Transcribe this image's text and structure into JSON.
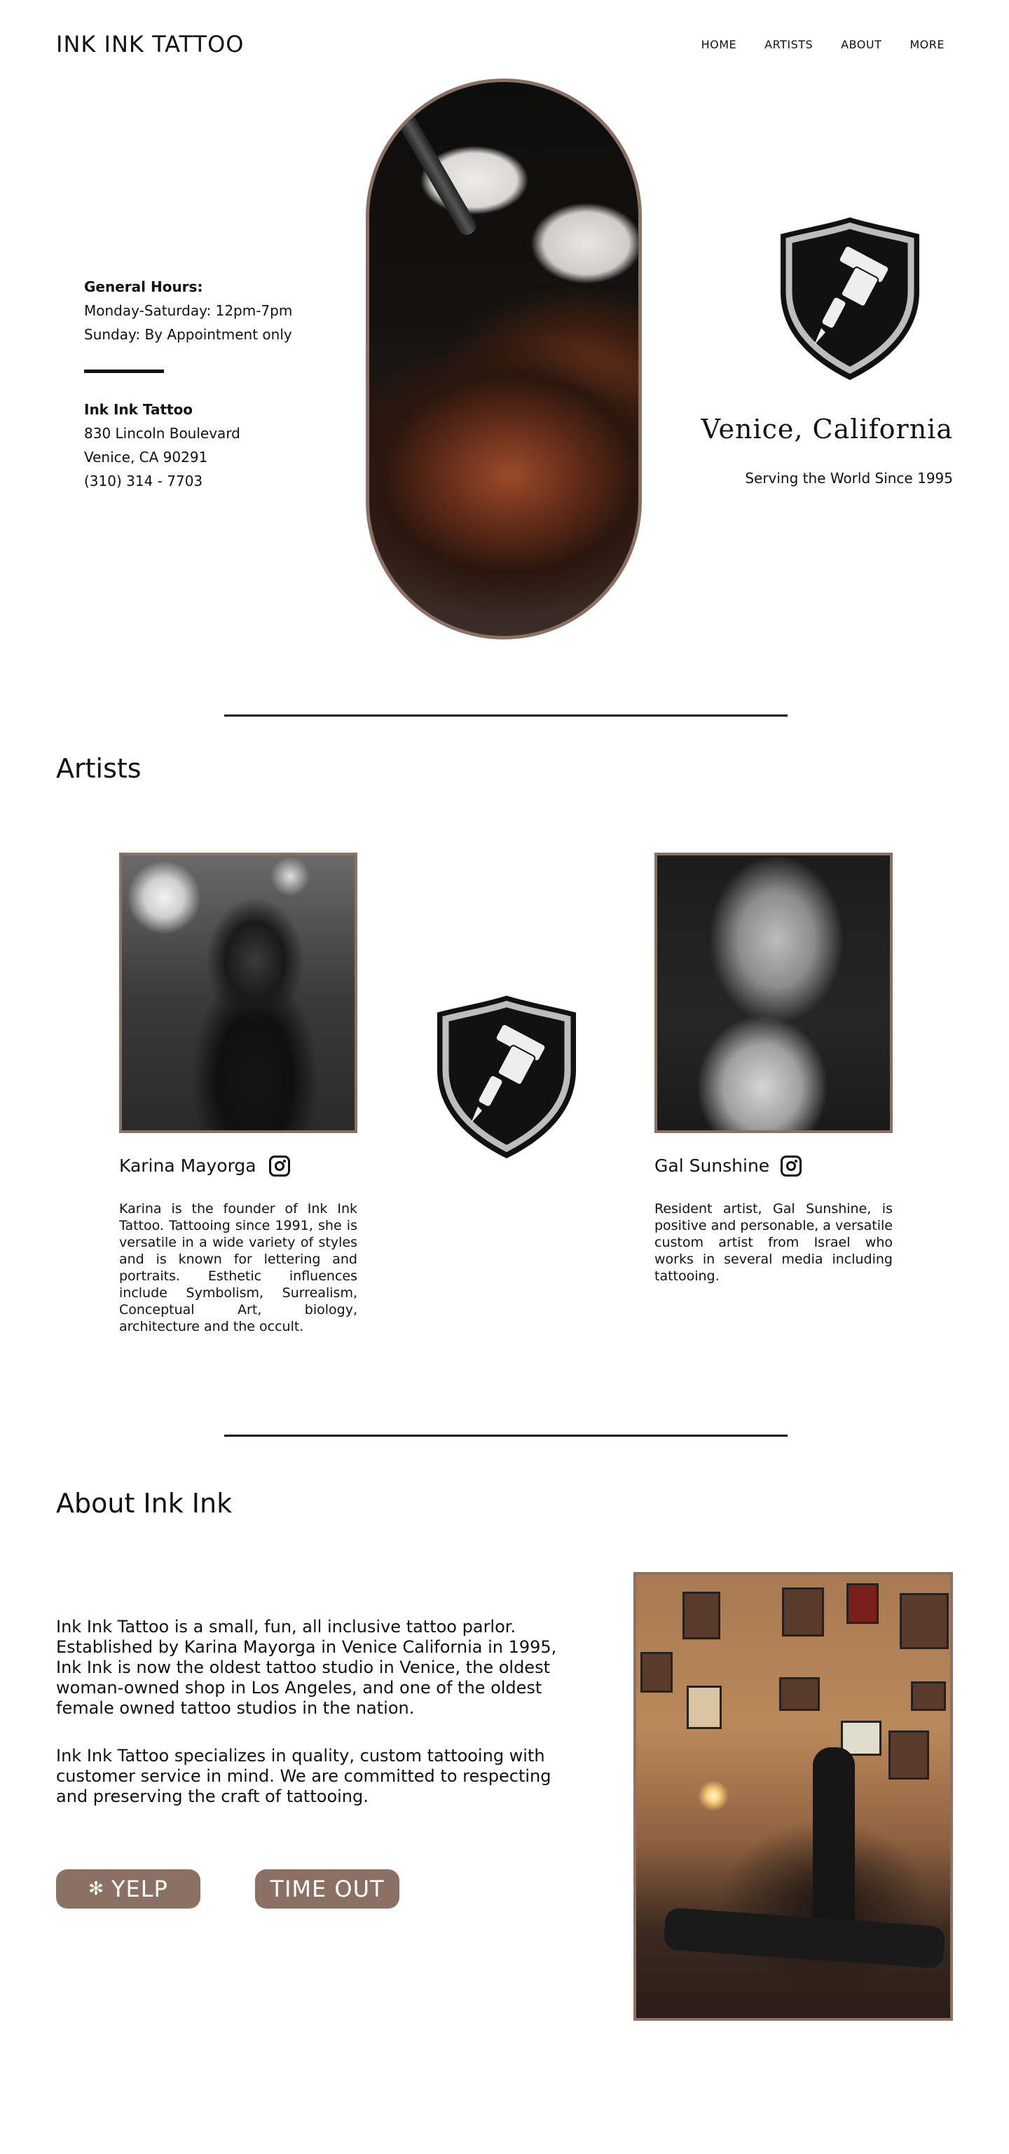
{
  "header": {
    "logo": "INK INK TATTOO",
    "nav": [
      "HOME",
      "ARTISTS",
      "ABOUT",
      "MORE"
    ]
  },
  "hero": {
    "hours_title": "General Hours:",
    "hours_line1": "Monday-Saturday: 12pm-7pm",
    "hours_line2": "Sunday: By Appointment only",
    "shop_name": "Ink Ink Tattoo",
    "address1": "830 Lincoln Boulevard",
    "address2": "Venice, CA 90291",
    "phone": "(310) 314 - 7703",
    "city": "Venice, California",
    "tagline": "Serving the World Since 1995"
  },
  "artists": {
    "title": "Artists",
    "items": [
      {
        "name": "Karina Mayorga",
        "bio": "Karina is the founder of Ink Ink Tattoo. Tattooing since 1991, she is versatile in a wide variety of styles and is known for lettering and portraits. Esthetic influences include Symbolism, Surrealism, Conceptual Art, biology, architecture and the occult."
      },
      {
        "name": "Gal Sunshine",
        "bio": "Resident artist, Gal Sunshine, is positive and personable, a versatile custom artist from Israel who works in several media including tattooing."
      }
    ]
  },
  "about": {
    "title": "About Ink Ink",
    "p1": "Ink Ink Tattoo is a small, fun, all inclusive tattoo parlor. Established by Karina Mayorga in Venice California in 1995, Ink Ink is now the oldest tattoo studio in Venice, the oldest woman-owned shop in Los Angeles, and one of the oldest female owned tattoo studios in the nation.",
    "p2": "Ink Ink Tattoo specializes in quality, custom tattooing with customer service in mind. We are committed to respecting and preserving the craft of tattooing.",
    "yelp_label": "YELP",
    "timeout_label": "TIME OUT"
  },
  "colors": {
    "accent": "#8b7163",
    "text": "#111111"
  },
  "icons": [
    "instagram-icon",
    "yelp-icon",
    "tattoo-machine-shield-icon"
  ]
}
